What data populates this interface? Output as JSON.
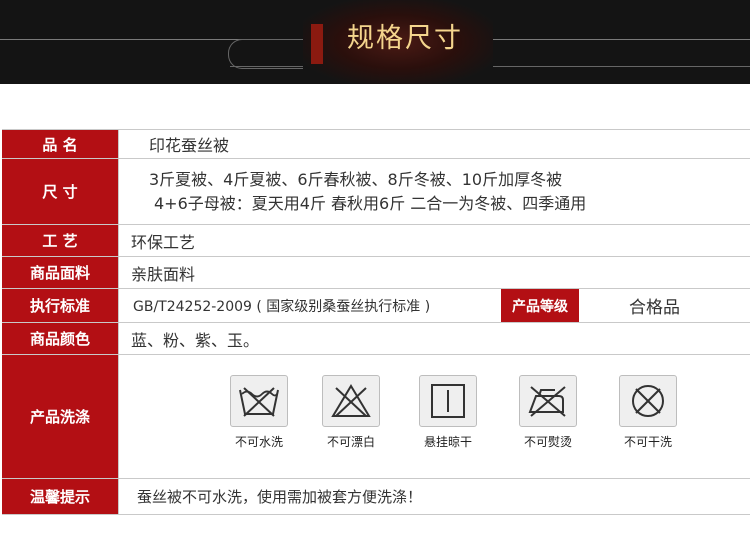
{
  "banner": {
    "title": "规格尺寸"
  },
  "spec": {
    "name": {
      "label": "品 名",
      "value": "印花蚕丝被"
    },
    "size": {
      "label": "尺 寸",
      "line1": "3斤夏被、4斤夏被、6斤春秋被、8斤冬被、10斤加厚冬被",
      "line2": "4+6子母被：夏天用4斤 春秋用6斤 二合一为冬被、四季通用"
    },
    "craft": {
      "label": "工 艺",
      "value": "环保工艺"
    },
    "fabric": {
      "label": "商品面料",
      "value": "亲肤面料"
    },
    "standard": {
      "label": "执行标准",
      "value": "GB/T24252-2009 ( 国家级别桑蚕丝执行标准 )",
      "grade_label": "产品等级",
      "grade_value": "合格品"
    },
    "color": {
      "label": "商品颜色",
      "value": "蓝、粉、紫、玉。"
    },
    "wash": {
      "label": "产品洗涤",
      "items": [
        {
          "icon": "no-wash-icon",
          "caption": "不可水洗"
        },
        {
          "icon": "no-bleach-icon",
          "caption": "不可漂白"
        },
        {
          "icon": "hang-dry-icon",
          "caption": "悬挂晾干"
        },
        {
          "icon": "no-iron-icon",
          "caption": "不可熨烫"
        },
        {
          "icon": "no-dry-clean-icon",
          "caption": "不可干洗"
        }
      ]
    },
    "tip": {
      "label": "温馨提示",
      "value": "蚕丝被不可水洗，使用需加被套方便洗涤！"
    }
  },
  "colors": {
    "label_bg": "#b30f14",
    "banner_bg": "#141414",
    "title_gold": "#f4d58d"
  }
}
